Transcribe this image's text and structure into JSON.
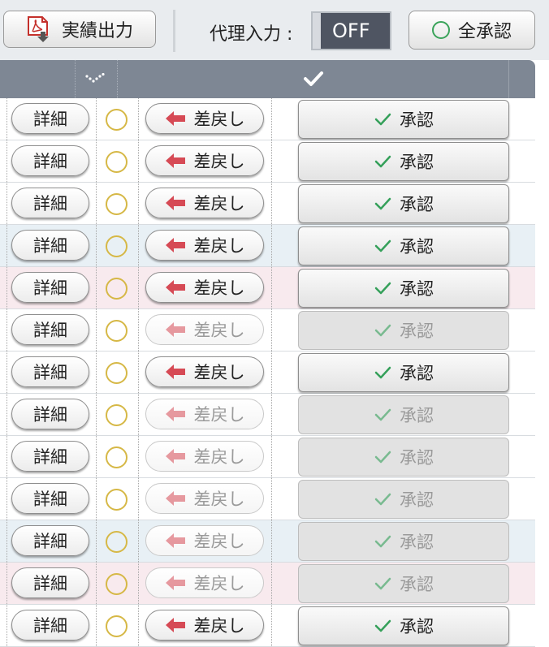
{
  "toolbar": {
    "export_label": "実績出力",
    "proxy_label": "代理入力 :",
    "proxy_state": "OFF",
    "approve_all_label": "全承認"
  },
  "colors": {
    "header_bg": "#7e8794",
    "return_arrow": "#d64a55",
    "approve_check": "#35a05a",
    "pending_circle": "#d6b846"
  },
  "rows": [
    {
      "detail": "詳細",
      "return": "差戻し",
      "approve": "承認",
      "enabled": true,
      "tint": "none"
    },
    {
      "detail": "詳細",
      "return": "差戻し",
      "approve": "承認",
      "enabled": true,
      "tint": "none"
    },
    {
      "detail": "詳細",
      "return": "差戻し",
      "approve": "承認",
      "enabled": true,
      "tint": "none"
    },
    {
      "detail": "詳細",
      "return": "差戻し",
      "approve": "承認",
      "enabled": true,
      "tint": "blue"
    },
    {
      "detail": "詳細",
      "return": "差戻し",
      "approve": "承認",
      "enabled": true,
      "tint": "pink"
    },
    {
      "detail": "詳細",
      "return": "差戻し",
      "approve": "承認",
      "enabled": false,
      "tint": "none"
    },
    {
      "detail": "詳細",
      "return": "差戻し",
      "approve": "承認",
      "enabled": true,
      "tint": "none"
    },
    {
      "detail": "詳細",
      "return": "差戻し",
      "approve": "承認",
      "enabled": false,
      "tint": "none"
    },
    {
      "detail": "詳細",
      "return": "差戻し",
      "approve": "承認",
      "enabled": false,
      "tint": "none"
    },
    {
      "detail": "詳細",
      "return": "差戻し",
      "approve": "承認",
      "enabled": false,
      "tint": "none"
    },
    {
      "detail": "詳細",
      "return": "差戻し",
      "approve": "承認",
      "enabled": false,
      "tint": "blue"
    },
    {
      "detail": "詳細",
      "return": "差戻し",
      "approve": "承認",
      "enabled": false,
      "tint": "pink"
    },
    {
      "detail": "詳細",
      "return": "差戻し",
      "approve": "承認",
      "enabled": true,
      "tint": "none"
    }
  ]
}
